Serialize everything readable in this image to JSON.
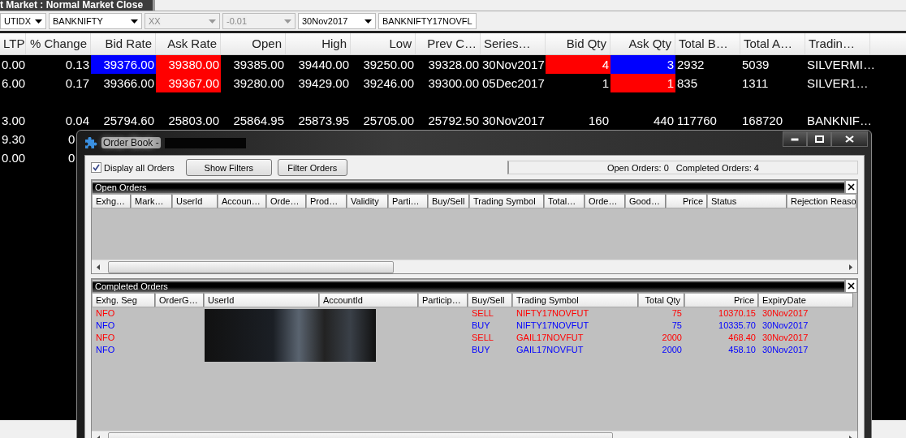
{
  "top_tab": {
    "label": "t Market : Normal Market Close"
  },
  "toolbar": {
    "dropdowns": [
      {
        "value": "UTIDX",
        "disabled": false
      },
      {
        "value": "BANKNIFTY",
        "disabled": false
      },
      {
        "value": "XX",
        "disabled": true
      },
      {
        "value": "-0.01",
        "disabled": true
      },
      {
        "value": "30Nov2017",
        "disabled": false
      },
      {
        "value": "BANKNIFTY17NOVFL",
        "disabled": false
      }
    ]
  },
  "market_watch": {
    "columns": [
      {
        "label": "LTP",
        "kind": "number"
      },
      {
        "label": "% Change",
        "kind": "number"
      },
      {
        "label": "Bid Rate",
        "kind": "number"
      },
      {
        "label": "Ask Rate",
        "kind": "number"
      },
      {
        "label": "Open",
        "kind": "number"
      },
      {
        "label": "High",
        "kind": "number"
      },
      {
        "label": "Low",
        "kind": "number"
      },
      {
        "label": "Prev C…",
        "kind": "number"
      },
      {
        "label": "Series…",
        "kind": "text"
      },
      {
        "label": "Bid Qty",
        "kind": "number"
      },
      {
        "label": "Ask Qty",
        "kind": "number"
      },
      {
        "label": "Total B…",
        "kind": "text"
      },
      {
        "label": "Total A…",
        "kind": "text"
      },
      {
        "label": "Tradin…",
        "kind": "text"
      }
    ],
    "rows": [
      {
        "kind": "data",
        "cells": [
          "0.00",
          "0.13",
          {
            "text": "39376.00",
            "color": "#0000ff"
          },
          {
            "text": "39380.00",
            "color": "#ff0000"
          },
          "39385.00",
          "39440.00",
          "39250.00",
          "39328.00",
          "30Nov2017",
          {
            "text": "4",
            "color": "#ff0000"
          },
          {
            "text": "3",
            "color": "#0000ff"
          },
          "2932",
          "5039",
          "SILVERMI…"
        ]
      },
      {
        "kind": "data",
        "cells": [
          "6.00",
          "0.17",
          "39366.00",
          {
            "text": "39367.00",
            "color": "#ff0000"
          },
          "39280.00",
          "39429.00",
          "39246.00",
          "39300.00",
          "05Dec2017",
          "1",
          {
            "text": "1",
            "color": "#ff0000"
          },
          "835",
          "1311",
          "SILVER1…"
        ]
      },
      {
        "kind": "blank"
      },
      {
        "kind": "data",
        "cells": [
          "3.00",
          "0.04",
          "25794.60",
          "25803.00",
          "25864.95",
          "25873.95",
          "25705.00",
          "25792.50",
          "30Nov2017",
          "160",
          "440",
          "117760",
          "168720",
          "BANKNIF…"
        ]
      },
      {
        "kind": "partial",
        "cells": [
          "9.30",
          "0"
        ]
      },
      {
        "kind": "partial",
        "cells": [
          "0.00",
          "0"
        ]
      }
    ]
  },
  "order_book": {
    "title": "Order Book -",
    "display_all": {
      "label": "Display all Orders",
      "checked": true
    },
    "buttons": [
      "Show Filters",
      "Filter Orders"
    ],
    "status": [
      "Open Orders: 0",
      "Completed Orders: 4"
    ],
    "open_orders": {
      "title": "Open Orders",
      "columns": [
        {
          "label": "Exhg…",
          "kind": "text"
        },
        {
          "label": "Mark…",
          "kind": "text"
        },
        {
          "label": "UserId",
          "kind": "text"
        },
        {
          "label": "Accoun…",
          "kind": "text"
        },
        {
          "label": "Orde…",
          "kind": "text"
        },
        {
          "label": "Prod…",
          "kind": "text"
        },
        {
          "label": "Validity",
          "kind": "text"
        },
        {
          "label": "Parti…",
          "kind": "text"
        },
        {
          "label": "Buy/Sell",
          "kind": "text"
        },
        {
          "label": "Trading Symbol",
          "kind": "text"
        },
        {
          "label": "Total…",
          "kind": "text"
        },
        {
          "label": "Orde…",
          "kind": "text"
        },
        {
          "label": "Good…",
          "kind": "text"
        },
        {
          "label": "Price",
          "kind": "number"
        },
        {
          "label": "Status",
          "kind": "text"
        },
        {
          "label": "Rejection Reaso",
          "kind": "text"
        }
      ]
    },
    "completed_orders": {
      "title": "Completed Orders",
      "columns": [
        {
          "label": "Exhg. Seg",
          "kind": "text"
        },
        {
          "label": "OrderG…",
          "kind": "text"
        },
        {
          "label": "UserId",
          "kind": "text"
        },
        {
          "label": "AccountId",
          "kind": "text"
        },
        {
          "label": "Particip…",
          "kind": "text"
        },
        {
          "label": "Buy/Sell",
          "kind": "text"
        },
        {
          "label": "Trading Symbol",
          "kind": "text"
        },
        {
          "label": "Total Qty",
          "kind": "number"
        },
        {
          "label": "Price",
          "kind": "number"
        },
        {
          "label": "ExpiryDate",
          "kind": "text"
        }
      ],
      "rows": [
        {
          "color": "#ff0000",
          "exchange": "NFO",
          "side": "SELL",
          "symbol": "NIFTY17NOVFUT",
          "qty": "75",
          "price": "10370.15",
          "expiry": "30Nov2017"
        },
        {
          "color": "#0000ff",
          "exchange": "NFO",
          "side": "BUY",
          "symbol": "NIFTY17NOVFUT",
          "qty": "75",
          "price": "10335.70",
          "expiry": "30Nov2017"
        },
        {
          "color": "#ff0000",
          "exchange": "NFO",
          "side": "SELL",
          "symbol": "GAIL17NOVFUT",
          "qty": "2000",
          "price": "468.40",
          "expiry": "30Nov2017"
        },
        {
          "color": "#0000ff",
          "exchange": "NFO",
          "side": "BUY",
          "symbol": "GAIL17NOVFUT",
          "qty": "2000",
          "price": "458.10",
          "expiry": "30Nov2017"
        }
      ]
    }
  }
}
